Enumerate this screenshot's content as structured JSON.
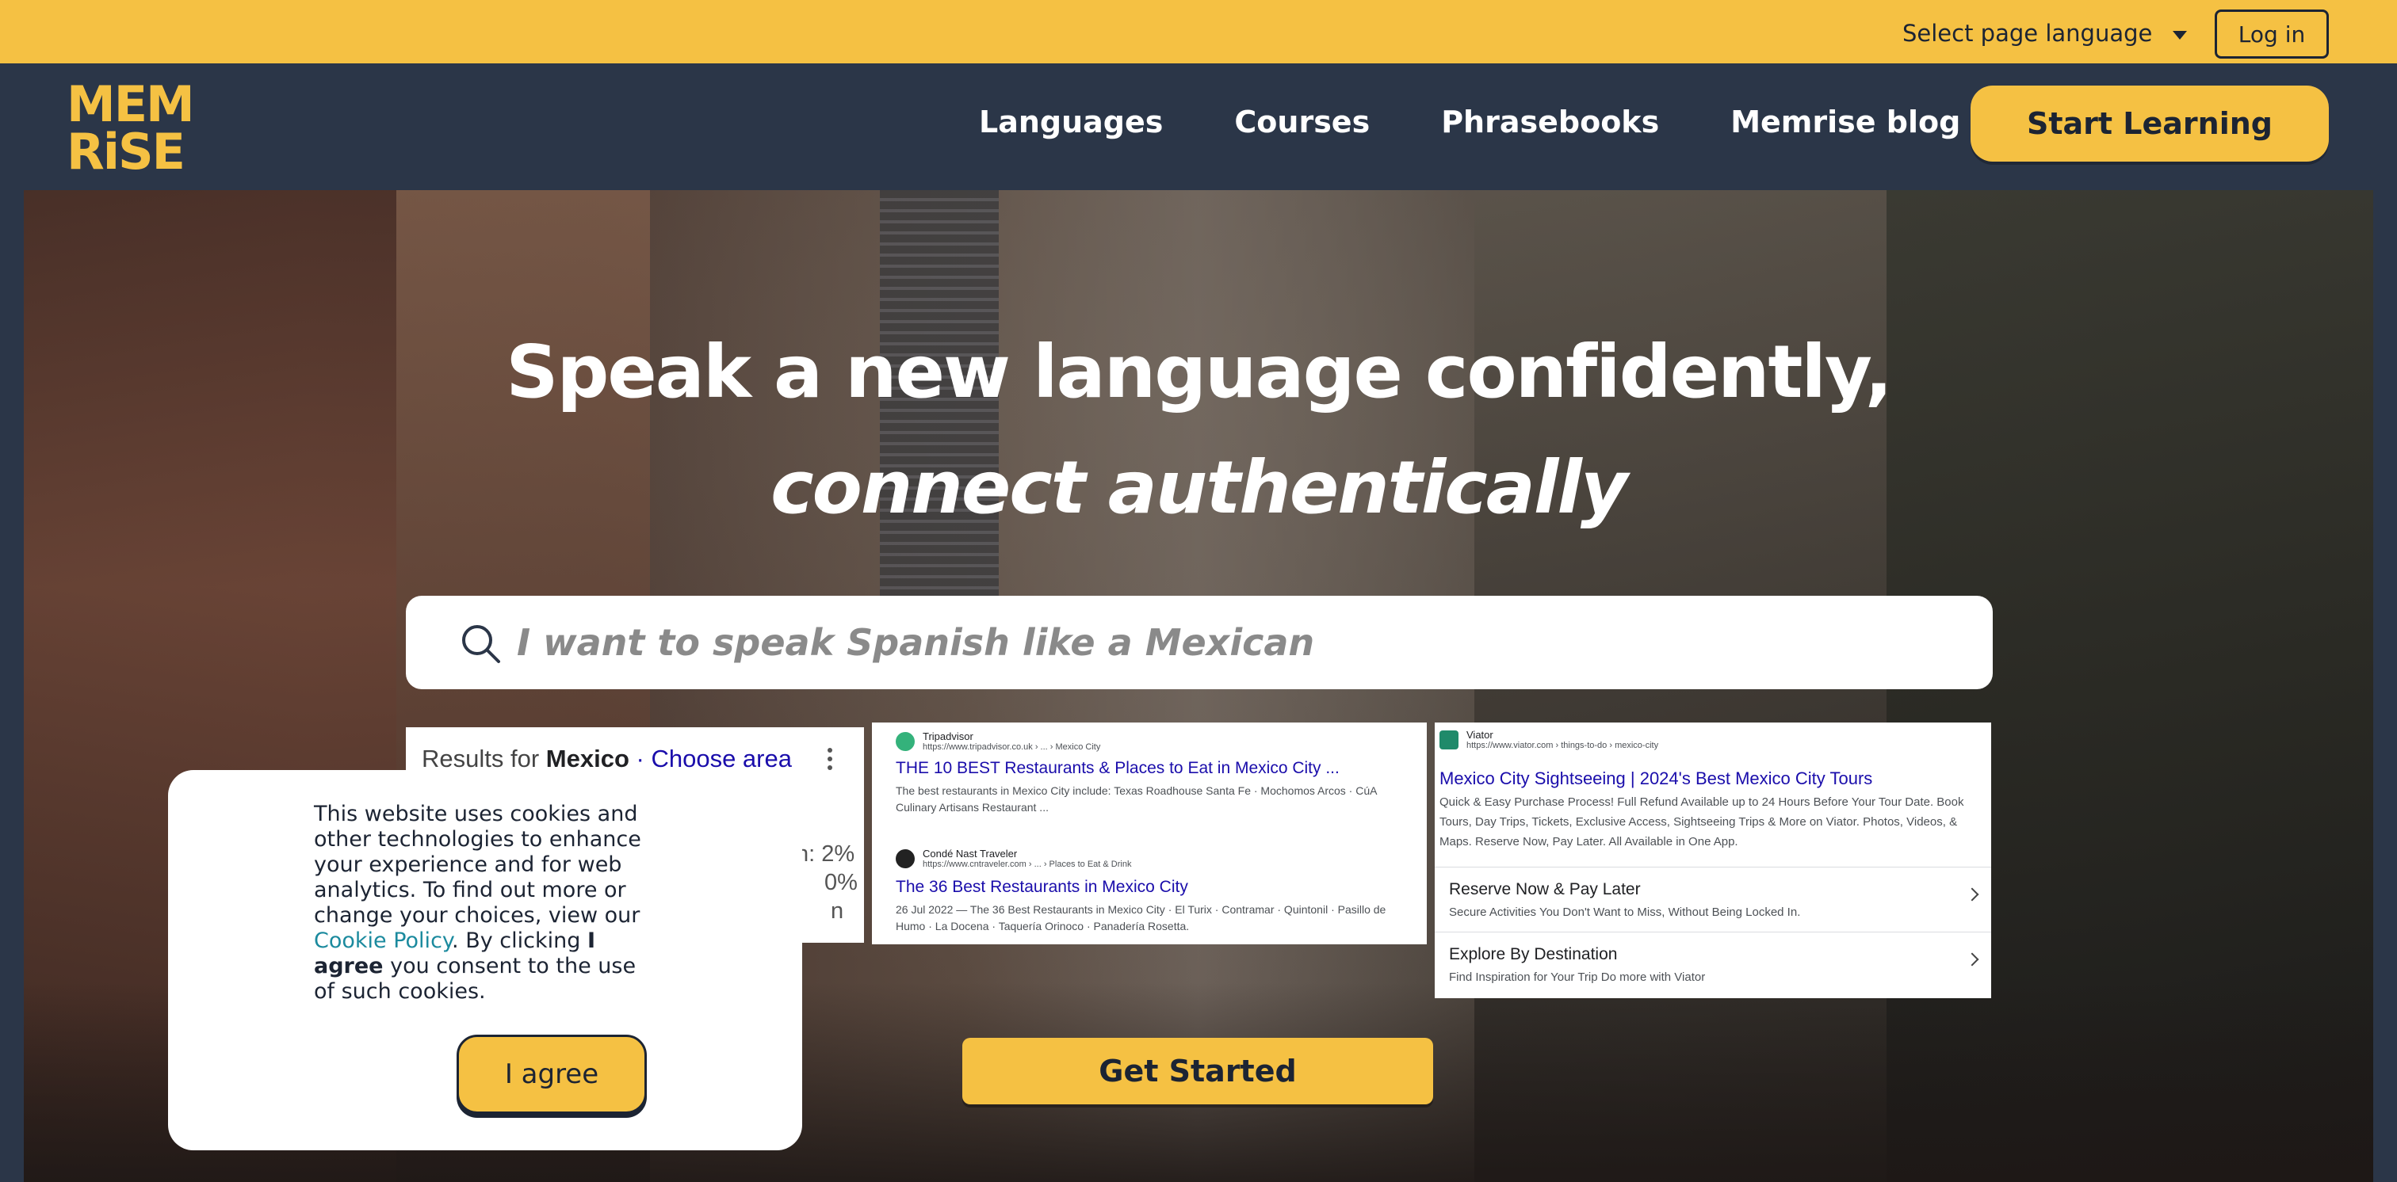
{
  "topbar": {
    "language_label": "Select page language",
    "login_label": "Log in"
  },
  "logo": {
    "line1": "MEM",
    "line2": "RiSE"
  },
  "nav": {
    "links": [
      "Languages",
      "Courses",
      "Phrasebooks",
      "Memrise blog"
    ],
    "cta_label": "Start Learning"
  },
  "hero": {
    "title_line1": "Speak a new language confidently,",
    "title_line2": "connect authentically",
    "search_placeholder": "I want to speak Spanish like a Mexican",
    "get_started_label": "Get Started"
  },
  "card1": {
    "results_for": "Results for",
    "location": "Mexico",
    "choose_area": "· Choose area",
    "frag1": "n: 2%",
    "frag2": "0%",
    "frag3": "n"
  },
  "card2": {
    "results": [
      {
        "source": "Tripadvisor",
        "url": "https://www.tripadvisor.co.uk › ... › Mexico City",
        "title": "THE 10 BEST Restaurants & Places to Eat in Mexico City ...",
        "desc": "The best restaurants in Mexico City include: Texas Roadhouse Santa Fe · Mochomos Arcos · CúA Culinary Artisans Restaurant ..."
      },
      {
        "source": "Condé Nast Traveler",
        "url": "https://www.cntraveler.com › ... › Places to Eat & Drink",
        "title": "The 36 Best Restaurants in Mexico City",
        "desc": "26 Jul 2022 — The 36 Best Restaurants in Mexico City · El Turix · Contramar · Quintonil · Pasillo de Humo · La Docena · Taquería Orinoco · Panadería Rosetta."
      }
    ]
  },
  "card3": {
    "source": "Viator",
    "url": "https://www.viator.com › things-to-do › mexico-city",
    "title": "Mexico City Sightseeing | 2024's Best Mexico City Tours",
    "desc": "Quick & Easy Purchase Process! Full Refund Available up to 24 Hours Before Your Tour Date. Book Tours, Day Trips, Tickets, Exclusive Access, Sightseeing Trips & More on Viator. Photos, Videos, & Maps. Reserve Now, Pay Later. All Available in One App.",
    "sublinks": [
      {
        "title": "Reserve Now & Pay Later",
        "desc": "Secure Activities You Don't Want to Miss, Without Being Locked In."
      },
      {
        "title": "Explore By Destination",
        "desc": "Find Inspiration for Your Trip Do more with Viator"
      }
    ]
  },
  "cookie": {
    "text_before": "This website uses cookies and other technologies to enhance your experience and for web analytics. To find out more or change your choices, view our",
    "policy_link": "Cookie Policy",
    "text_mid": ". By clicking",
    "agree_bold": "I agree",
    "text_after": "you consent to the use of such cookies.",
    "agree_button": "I agree"
  },
  "colors": {
    "brand_yellow": "#f5c143",
    "navy": "#2b3648",
    "link_teal": "#1b8a9e"
  }
}
